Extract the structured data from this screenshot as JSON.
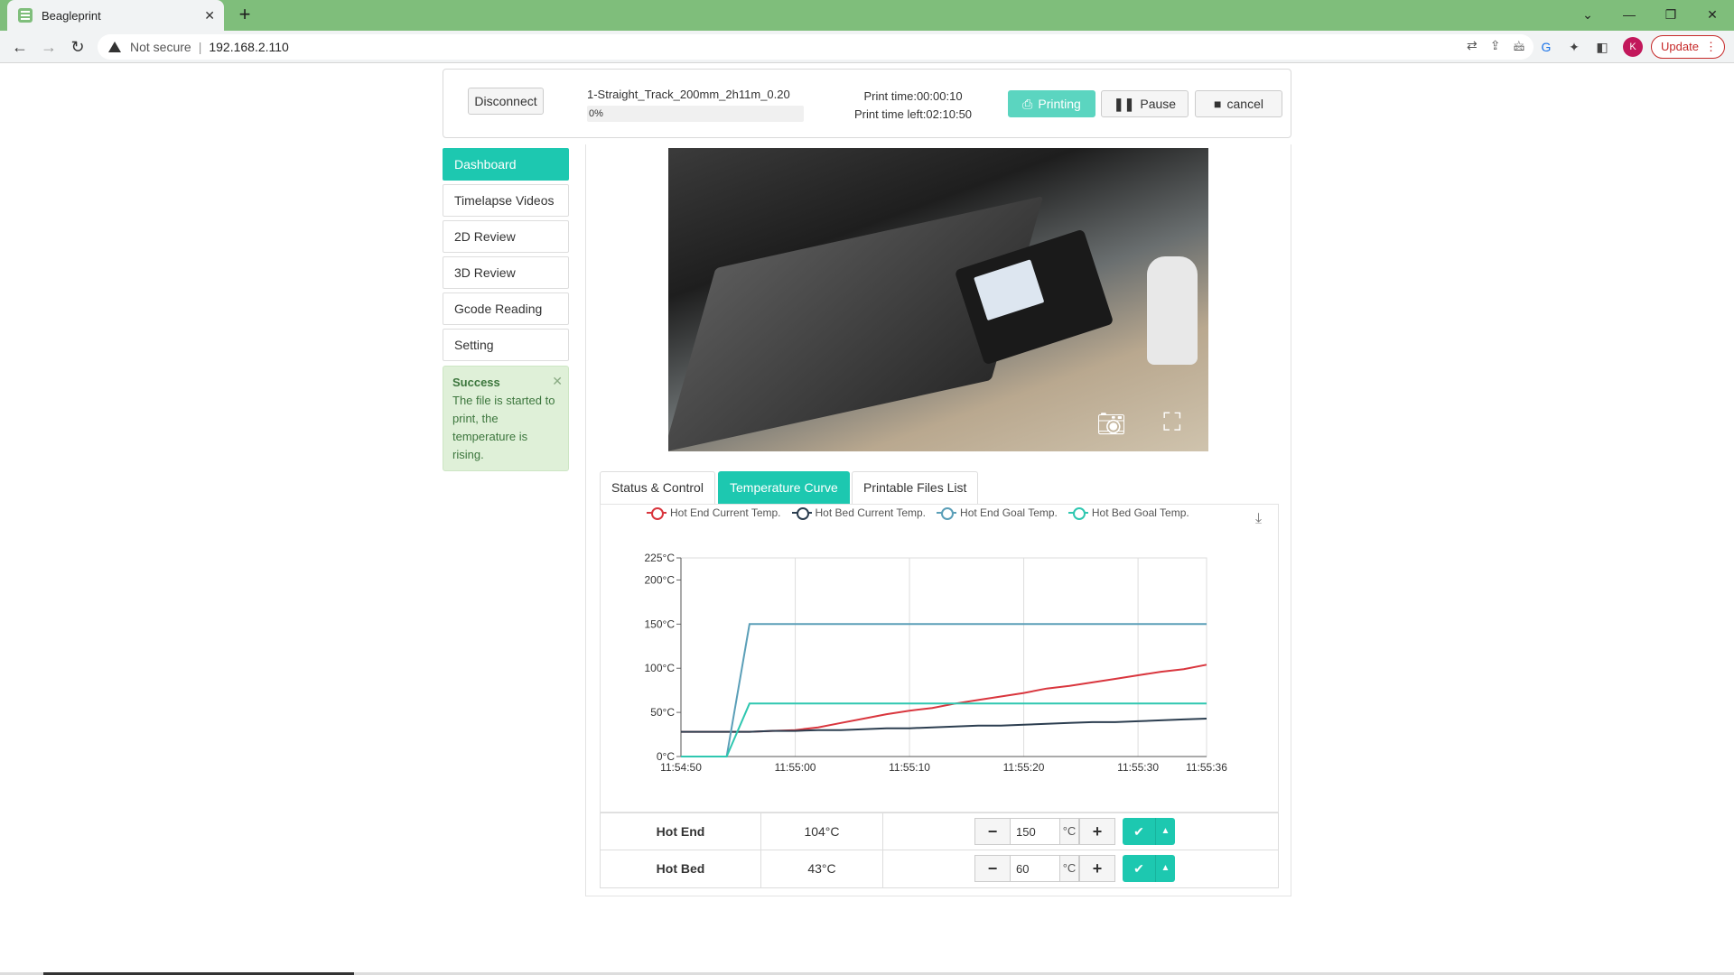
{
  "browser": {
    "tab_title": "Beagleprint",
    "not_secure": "Not secure",
    "url": "192.168.2.110",
    "update_label": "Update",
    "avatar_initial": "K"
  },
  "header": {
    "disconnect_label": "Disconnect",
    "filename": "1-Straight_Track_200mm_2h11m_0.20",
    "progress_text": "0%",
    "progress_value": 0,
    "print_time": "Print time:00:00:10",
    "print_time_left": "Print time left:02:10:50",
    "printing_label": "Printing",
    "pause_label": "Pause",
    "cancel_label": "cancel"
  },
  "sidebar": {
    "items": [
      {
        "label": "Dashboard",
        "active": true
      },
      {
        "label": "Timelapse Videos"
      },
      {
        "label": "2D Review"
      },
      {
        "label": "3D Review"
      },
      {
        "label": "Gcode Reading"
      },
      {
        "label": "Setting"
      }
    ]
  },
  "alert": {
    "title": "Success",
    "message": "The file is started to print, the temperature is rising."
  },
  "tabs": [
    {
      "label": "Status & Control"
    },
    {
      "label": "Temperature Curve",
      "active": true
    },
    {
      "label": "Printable Files List"
    }
  ],
  "chart_data": {
    "type": "line",
    "x": [
      "11:54:50",
      "11:54:52",
      "11:54:54",
      "11:54:56",
      "11:54:58",
      "11:55:00",
      "11:55:02",
      "11:55:04",
      "11:55:06",
      "11:55:08",
      "11:55:10",
      "11:55:12",
      "11:55:14",
      "11:55:16",
      "11:55:18",
      "11:55:20",
      "11:55:22",
      "11:55:24",
      "11:55:26",
      "11:55:28",
      "11:55:30",
      "11:55:32",
      "11:55:34",
      "11:55:36"
    ],
    "x_ticks": [
      "11:54:50",
      "11:55:00",
      "11:55:10",
      "11:55:20",
      "11:55:30",
      "11:55:36"
    ],
    "y_ticks": [
      "0°C",
      "50°C",
      "100°C",
      "150°C",
      "200°C",
      "225°C"
    ],
    "ylim": [
      0,
      225
    ],
    "grid": true,
    "legend_position": "top",
    "series": [
      {
        "name": "Hot End Current Temp.",
        "color": "#d9363e",
        "values": [
          28,
          28,
          28,
          28,
          29,
          30,
          33,
          38,
          43,
          48,
          52,
          55,
          60,
          64,
          68,
          72,
          77,
          80,
          84,
          88,
          92,
          96,
          99,
          104
        ]
      },
      {
        "name": "Hot Bed Current Temp.",
        "color": "#2c3e50",
        "values": [
          28,
          28,
          28,
          28,
          29,
          29,
          30,
          30,
          31,
          32,
          32,
          33,
          34,
          35,
          35,
          36,
          37,
          38,
          39,
          39,
          40,
          41,
          42,
          43
        ]
      },
      {
        "name": "Hot End Goal Temp.",
        "color": "#5b9fb8",
        "values": [
          0,
          0,
          0,
          150,
          150,
          150,
          150,
          150,
          150,
          150,
          150,
          150,
          150,
          150,
          150,
          150,
          150,
          150,
          150,
          150,
          150,
          150,
          150,
          150
        ]
      },
      {
        "name": "Hot Bed Goal Temp.",
        "color": "#2fc7b0",
        "values": [
          0,
          0,
          0,
          60,
          60,
          60,
          60,
          60,
          60,
          60,
          60,
          60,
          60,
          60,
          60,
          60,
          60,
          60,
          60,
          60,
          60,
          60,
          60,
          60
        ]
      }
    ]
  },
  "controls": [
    {
      "name": "Hot End",
      "current": "104°C",
      "goal": "150",
      "unit": "°C"
    },
    {
      "name": "Hot Bed",
      "current": "43°C",
      "goal": "60",
      "unit": "°C"
    }
  ]
}
